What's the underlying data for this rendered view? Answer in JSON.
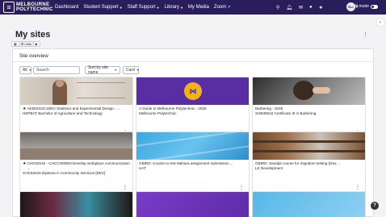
{
  "brand": {
    "line1": "MELBOURNE",
    "line2": "POLYTECHNIC"
  },
  "nav": [
    {
      "label": "Dashboard",
      "caret": false
    },
    {
      "label": "Student Support",
      "caret": true
    },
    {
      "label": "Staff Support",
      "caret": true
    },
    {
      "label": "Library",
      "caret": true
    },
    {
      "label": "My Media",
      "caret": false
    },
    {
      "label": "Zoom",
      "caret": false
    }
  ],
  "user": {
    "initials": "GR",
    "edit_mode_label": "Edit mode"
  },
  "page": {
    "title": "My sites"
  },
  "toolbar": {
    "label": "Lists"
  },
  "overview": {
    "title": "Site overview",
    "filter_all": "All",
    "search_placeholder": "Search",
    "sort_label": "Sort by site name",
    "view_label": "Card"
  },
  "courses": [
    {
      "title": "AEM2015C15EO Statistics and Experimental Design - ...",
      "sub": "HEPBAT Bachelor of Agriculture and Technology",
      "starred": true,
      "image": "people-whiteboard"
    },
    {
      "title": "A Guide to Melbourne Polytechnic - 2025",
      "sub": "Melbourne Polytechnic",
      "starred": false,
      "image": "purple-logo"
    },
    {
      "title": "Barbering - 2025",
      "sub": "SHB30516 Certificate III in Barbering",
      "starred": false,
      "image": "barber"
    },
    {
      "title": "CHC52015 - CHCCOM003 Develop workplace communication ...",
      "sub": "CHC52015 Diploma in Community Services [DEV]",
      "starred": true,
      "image": "classroom"
    },
    {
      "title": "GBIRD: Course to test Mahara assignment submission ...",
      "sub": "UAT",
      "starred": false,
      "image": "blue-wave"
    },
    {
      "title": "GBIRD: Sandpit course for migration testing (Dev, ...",
      "sub": "LE Development",
      "starred": false,
      "image": "library"
    }
  ],
  "icons": {
    "help": "?",
    "drawer": "‹"
  }
}
